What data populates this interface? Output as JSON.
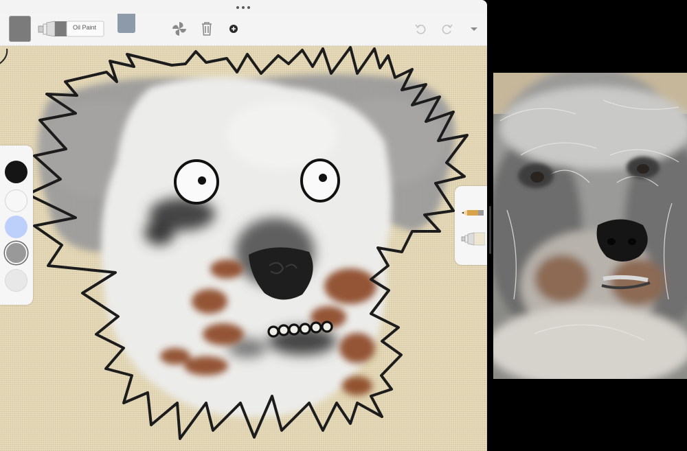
{
  "toolbar": {
    "brush_name": "Oil Paint",
    "current_color": "#7b7b7b",
    "tab_swatch_color": "#8c9aaa",
    "icons": [
      "pinwheel-icon",
      "trash-icon",
      "plus-circle-icon",
      "undo-icon",
      "redo-icon",
      "chevron-down-icon"
    ]
  },
  "palette": {
    "colors": [
      "#151515",
      "#f7f7f7",
      "#bcd0fb",
      "#999999",
      "#e8e8e8"
    ]
  },
  "tools": {
    "icons": [
      "pencil-icon",
      "paint-tube-icon"
    ]
  },
  "canvas": {
    "paper_color": "#e2d6b4"
  }
}
